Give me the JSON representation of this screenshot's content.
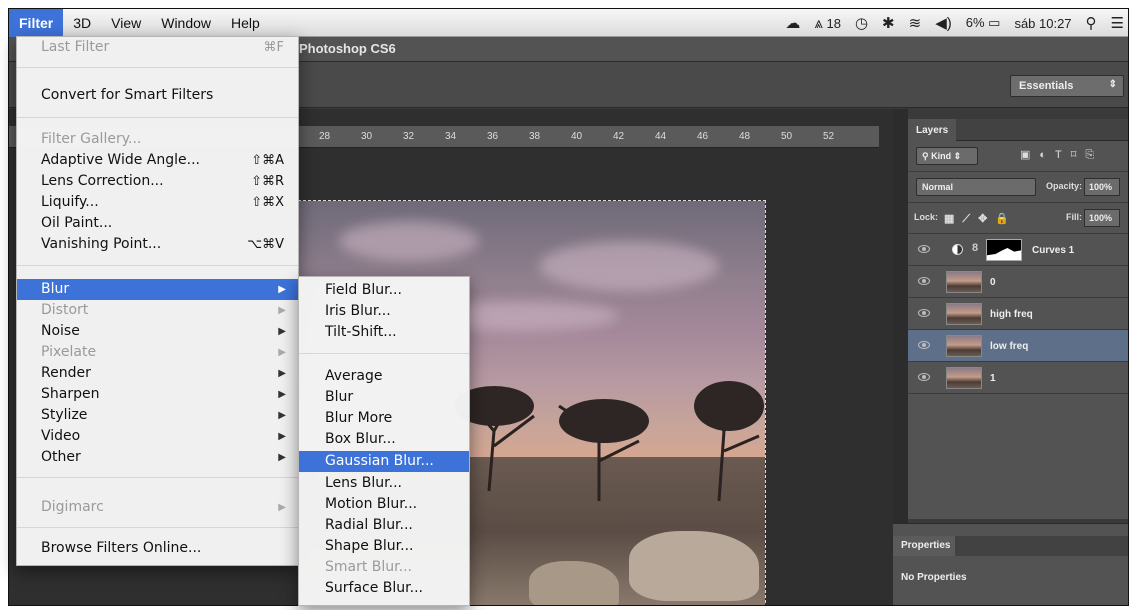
{
  "menubar": {
    "items": [
      "Filter",
      "3D",
      "View",
      "Window",
      "Help"
    ],
    "active_index": 0,
    "status": {
      "battery_text": "6%",
      "clock": "sáb 10:27",
      "counter": "18"
    }
  },
  "app": {
    "title": "Photoshop CS6",
    "workspace": "Essentials"
  },
  "ruler": {
    "ticks": [
      "28",
      "30",
      "32",
      "34",
      "36",
      "38",
      "40",
      "42",
      "44",
      "46",
      "48",
      "50",
      "52"
    ]
  },
  "filter_menu": {
    "items": [
      {
        "label": "Last Filter",
        "shortcut": "⌘F",
        "disabled": true
      },
      {
        "label": "Convert for Smart Filters"
      },
      {
        "label": "Filter Gallery...",
        "disabled": true
      },
      {
        "label": "Adaptive Wide Angle...",
        "shortcut": "⇧⌘A"
      },
      {
        "label": "Lens Correction...",
        "shortcut": "⇧⌘R"
      },
      {
        "label": "Liquify...",
        "shortcut": "⇧⌘X"
      },
      {
        "label": "Oil Paint..."
      },
      {
        "label": "Vanishing Point...",
        "shortcut": "⌥⌘V"
      },
      {
        "label": "Blur",
        "submenu": true,
        "highlighted": true
      },
      {
        "label": "Distort",
        "submenu": true,
        "disabled": true
      },
      {
        "label": "Noise",
        "submenu": true
      },
      {
        "label": "Pixelate",
        "submenu": true,
        "disabled": true
      },
      {
        "label": "Render",
        "submenu": true
      },
      {
        "label": "Sharpen",
        "submenu": true
      },
      {
        "label": "Stylize",
        "submenu": true
      },
      {
        "label": "Video",
        "submenu": true
      },
      {
        "label": "Other",
        "submenu": true
      },
      {
        "label": "Digimarc",
        "submenu": true,
        "disabled": true
      },
      {
        "label": "Browse Filters Online..."
      }
    ]
  },
  "blur_menu": {
    "items": [
      {
        "label": "Field Blur..."
      },
      {
        "label": "Iris Blur..."
      },
      {
        "label": "Tilt-Shift..."
      },
      {
        "label": "Average"
      },
      {
        "label": "Blur"
      },
      {
        "label": "Blur More"
      },
      {
        "label": "Box Blur..."
      },
      {
        "label": "Gaussian Blur...",
        "highlighted": true
      },
      {
        "label": "Lens Blur..."
      },
      {
        "label": "Motion Blur..."
      },
      {
        "label": "Radial Blur..."
      },
      {
        "label": "Shape Blur..."
      },
      {
        "label": "Smart Blur...",
        "disabled": true
      },
      {
        "label": "Surface Blur..."
      }
    ]
  },
  "layers_panel": {
    "tab": "Layers",
    "kind_label": "Kind",
    "blend_mode": "Normal",
    "opacity_label": "Opacity:",
    "opacity_value": "100%",
    "lock_label": "Lock:",
    "fill_label": "Fill:",
    "fill_value": "100%",
    "layers": [
      {
        "name": "Curves 1",
        "type": "adjustment"
      },
      {
        "name": "0"
      },
      {
        "name": "high freq"
      },
      {
        "name": "low freq",
        "selected": true
      },
      {
        "name": "1"
      }
    ]
  },
  "properties_panel": {
    "tab": "Properties",
    "text": "No Properties"
  },
  "colors": {
    "menu_highlight": "#3d72d9",
    "panel_bg": "#535353",
    "selected_layer": "#5d6f89"
  }
}
